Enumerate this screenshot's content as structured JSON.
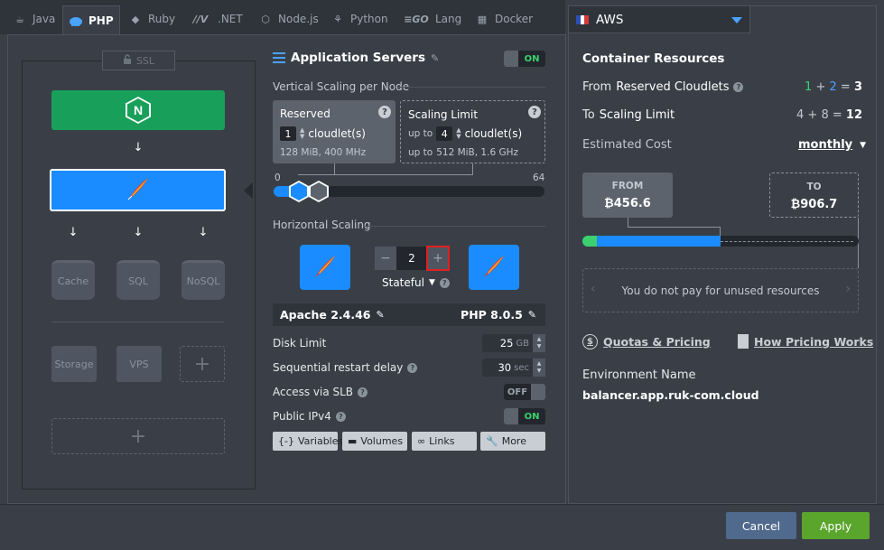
{
  "tabs": [
    {
      "label": "Java",
      "icon": "java-icon"
    },
    {
      "label": "PHP",
      "icon": "php-icon",
      "active": true
    },
    {
      "label": "Ruby",
      "icon": "ruby-icon"
    },
    {
      "label": ".NET",
      "icon": "dotnet-icon"
    },
    {
      "label": "Node.js",
      "icon": "nodejs-icon"
    },
    {
      "label": "Python",
      "icon": "python-icon"
    },
    {
      "label": "Lang",
      "icon": "go-icon"
    },
    {
      "label": "Docker",
      "icon": "docker-icon"
    }
  ],
  "topology": {
    "ssl_label": "SSL",
    "databases": [
      "Cache",
      "SQL",
      "NoSQL"
    ],
    "storage_label": "Storage",
    "vps_label": "VPS"
  },
  "config": {
    "title": "Application Servers",
    "toggle_label": "ON",
    "vertical_label": "Vertical Scaling per Node",
    "reserved": {
      "title": "Reserved",
      "value": "1",
      "unit": "cloudlet(s)",
      "spec": "128 MiB, 400 MHz"
    },
    "limit": {
      "title": "Scaling Limit",
      "prefix": "up to",
      "value": "4",
      "unit": "cloudlet(s)",
      "spec_prefix": "up to",
      "spec": "512 MiB, 1.6 GHz"
    },
    "slider_min": "0",
    "slider_max": "64",
    "slider_reserved": 1,
    "slider_limit": 4,
    "horizontal_label": "Horizontal Scaling",
    "node_count": "2",
    "mode": "Stateful",
    "server_version": "Apache 2.4.46",
    "engine_version": "PHP 8.0.5",
    "disk_label": "Disk Limit",
    "disk_value": "25",
    "disk_unit": "GB",
    "restart_label": "Sequential restart delay",
    "restart_value": "30",
    "restart_unit": "sec",
    "slb_label": "Access via SLB",
    "slb_toggle": "OFF",
    "ipv4_label": "Public IPv4",
    "ipv4_toggle": "ON",
    "buttons": [
      "Variables",
      "Volumes",
      "Links",
      "More"
    ]
  },
  "region": {
    "name": "AWS"
  },
  "resources": {
    "title": "Container Resources",
    "reserved_prefix": "From",
    "reserved_label": "Reserved Cloudlets",
    "reserved_a": "1",
    "reserved_b": "2",
    "reserved_total": "3",
    "limit_prefix": "To",
    "limit_label": "Scaling Limit",
    "limit_a": "4",
    "limit_b": "8",
    "limit_total": "12",
    "cost_label": "Estimated Cost",
    "period": "monthly",
    "from_label": "FROM",
    "from_value": "₿456.6",
    "to_label": "TO",
    "to_value": "₿906.7",
    "cost_fraction": 0.5,
    "info_text": "You do not pay for unused resources",
    "quotas_link": "Quotas & Pricing",
    "pricing_link": "How Pricing Works",
    "env_name_label": "Environment Name",
    "env_name": "balancer.app.ruk-com.cloud"
  },
  "footer": {
    "cancel_label": "Cancel",
    "apply_label": "Apply"
  },
  "colors": {
    "accent": "#1a8cff",
    "nginx_green": "#18a05a",
    "apply_green": "#5aa52c",
    "cancel_blue": "#4f6a8c"
  }
}
